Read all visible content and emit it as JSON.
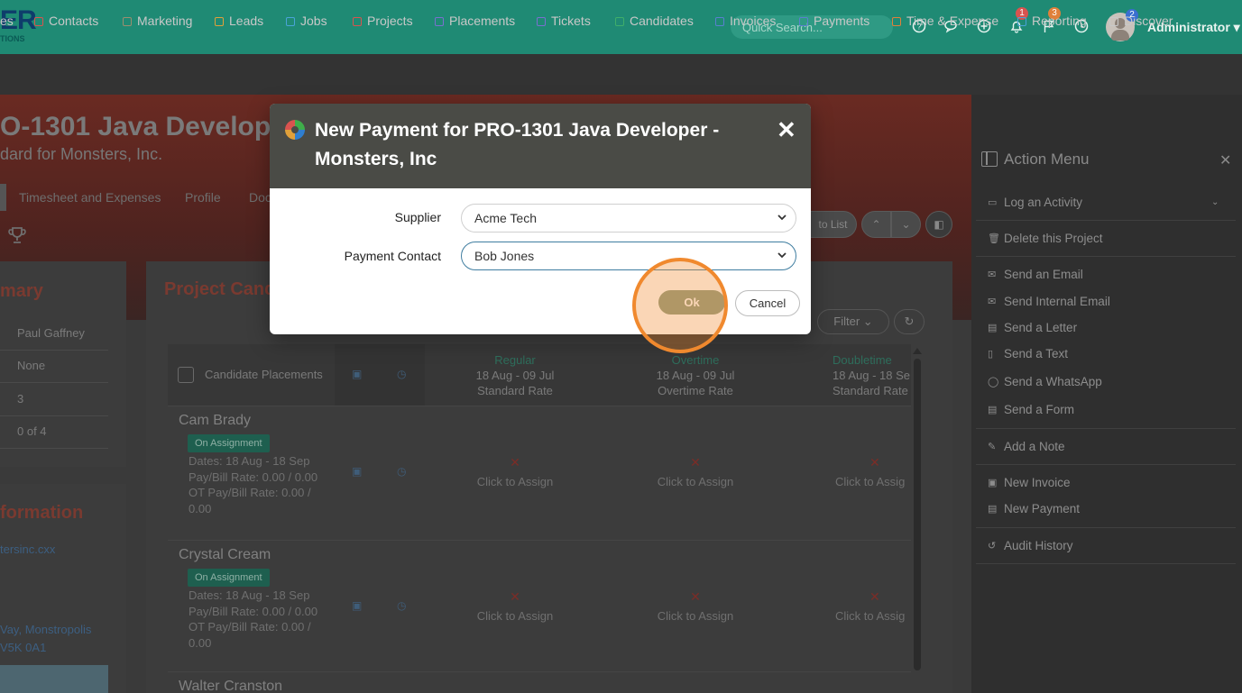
{
  "header": {
    "logo_main": "ER",
    "logo_sub": "TIONS",
    "search_placeholder": "Quick Search...",
    "notifications_count": "1",
    "flags_count": "3",
    "avatar_count": "2",
    "user_name": "Administrator ▾"
  },
  "nav": {
    "items": [
      {
        "label": "es",
        "color": "#c8c8c8"
      },
      {
        "label": "Contacts",
        "color": "#d9534f"
      },
      {
        "label": "Marketing",
        "color": "#9b8e6f"
      },
      {
        "label": "Leads",
        "color": "#e0a03a"
      },
      {
        "label": "Jobs",
        "color": "#4aa3d8"
      },
      {
        "label": "Projects",
        "color": "#d9534f"
      },
      {
        "label": "Placements",
        "color": "#7a6fd0"
      },
      {
        "label": "Tickets",
        "color": "#7a6fd0"
      },
      {
        "label": "Candidates",
        "color": "#3fae6a"
      },
      {
        "label": "Invoices",
        "color": "#5a7fd0"
      },
      {
        "label": "Payments",
        "color": "#5a7fd0"
      },
      {
        "label": "Time & Expense",
        "color": "#e0803a"
      },
      {
        "label": "Reporting",
        "color": "#4aa3d8"
      },
      {
        "label": "Discover",
        "color": "#c8c8c8"
      }
    ]
  },
  "page": {
    "title": "O-1301 Java Develop",
    "subtitle": "dard for Monsters, Inc.",
    "tabs": [
      "Timesheet and Expenses",
      "Profile",
      "Doc"
    ],
    "to_list_label": "to List",
    "summary_title": "mary",
    "summary_values": [
      "Paul Gaffney",
      "None",
      "3",
      "0 of 4"
    ],
    "info_title": "formation",
    "info_link_1": "tersinc.cxx",
    "info_link_2": "Vay, Monstropolis",
    "info_link_3": "V5K 0A1"
  },
  "main": {
    "title": "Project Cand",
    "filter_label": "Filter ⌄",
    "column_header": "Candidate Placements",
    "rate_columns": [
      {
        "title": "Regular",
        "dates": "18 Aug - 09 Jul",
        "rate": "Standard Rate"
      },
      {
        "title": "Overtime",
        "dates": "18 Aug - 09 Jul",
        "rate": "Overtime Rate"
      },
      {
        "title": "Doubletime",
        "dates": "18 Aug - 18 Se",
        "rate": "Standard Rate"
      }
    ],
    "candidates": [
      {
        "name": "Cam Brady",
        "status": "On Assignment",
        "dates": "Dates: 18 Aug - 18 Sep",
        "pay": "Pay/Bill Rate: 0.00 / 0.00",
        "ot": "OT Pay/Bill Rate: 0.00 / 0.00"
      },
      {
        "name": "Crystal Cream",
        "status": "On Assignment",
        "dates": "Dates: 18 Aug - 18 Sep",
        "pay": "Pay/Bill Rate: 0.00 / 0.00",
        "ot": "OT Pay/Bill Rate: 0.00 / 0.00"
      },
      {
        "name": "Walter Cranston"
      }
    ],
    "assign_text": "Click to Assign",
    "assign_text_cut": "Click to Assig"
  },
  "action_menu": {
    "title": "Action Menu",
    "items": [
      "Log an Activity",
      "Delete this Project",
      "Send an Email",
      "Send Internal Email",
      "Send a Letter",
      "Send a Text",
      "Send a WhatsApp",
      "Send a Form",
      "Add a Note",
      "New Invoice",
      "New Payment",
      "Audit History"
    ]
  },
  "modal": {
    "title": "New Payment for PRO-1301 Java Developer - Monsters, Inc",
    "supplier_label": "Supplier",
    "supplier_value": "Acme Tech",
    "contact_label": "Payment Contact",
    "contact_value": "Bob Jones",
    "ok_label": "Ok",
    "cancel_label": "Cancel"
  },
  "colors": {
    "topbar": "#1f8a74",
    "modal_header": "#4a4b46",
    "ok_button": "#8e9e84",
    "click_highlight": "#f0892e"
  }
}
